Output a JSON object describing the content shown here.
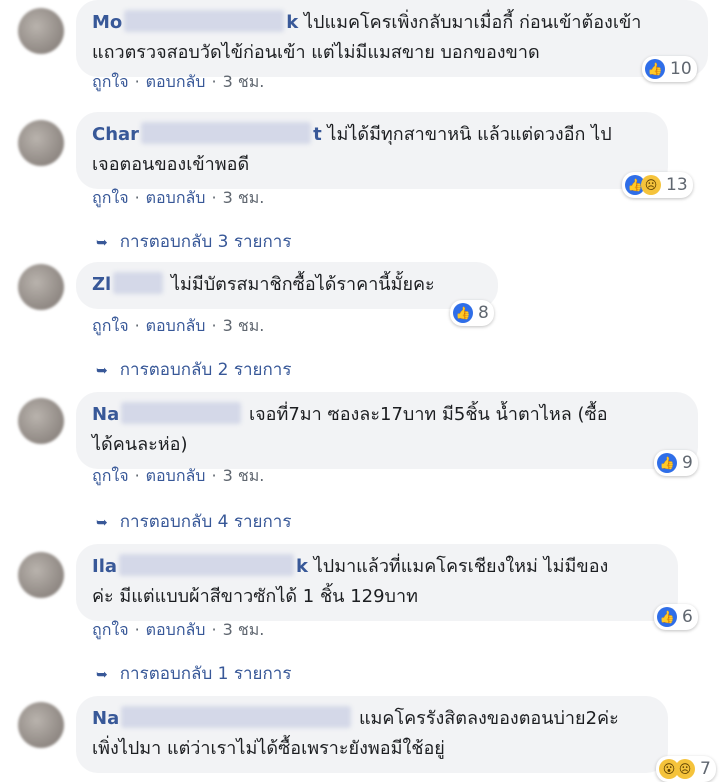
{
  "comments": [
    {
      "name": "Mo",
      "name_tail": "k",
      "text1": "ไปแมคโครเพิ่งกลับมาเมื่อกี้ ก่อนเข้าต้องเข้า",
      "text2": "แถวตรวจสอบวัดไข้ก่อนเข้า แต่ไม่มีแมสขาย บอกของขาด",
      "like": "ถูกใจ",
      "reply": "ตอบกลับ",
      "time": "3 ชม.",
      "reactions": "10",
      "replies": ""
    },
    {
      "name": "Char",
      "name_tail": "t",
      "text1": "ไม่ได้มีทุกสาขาหนิ แล้วแต่ดวงอีก ไป",
      "text2": "เจอตอนของเข้าพอดี",
      "like": "ถูกใจ",
      "reply": "ตอบกลับ",
      "time": "3 ชม.",
      "reactions": "13",
      "replies": "การตอบกลับ 3 รายการ"
    },
    {
      "name": "Zl",
      "text1": "ไม่มีบัตรสมาชิกซื้อได้ราคานี้มั้ยคะ",
      "like": "ถูกใจ",
      "reply": "ตอบกลับ",
      "time": "3 ชม.",
      "reactions": "8",
      "replies": "การตอบกลับ 2 รายการ"
    },
    {
      "name": "Na",
      "text1": "เจอที่7มา ซองละ17บาท มี5ชิ้น น้ำตาไหล (ซื้อ",
      "text2": "ได้คนละห่อ)",
      "like": "ถูกใจ",
      "reply": "ตอบกลับ",
      "time": "3 ชม.",
      "reactions": "9",
      "replies": "การตอบกลับ 4 รายการ"
    },
    {
      "name": "Ila",
      "name_tail": "k",
      "text1": "ไปมาแล้วที่แมคโครเชียงใหม่ ไม่มีของ",
      "text2": "ค่ะ มีแต่แบบผ้าสีขาวซักได้ 1 ชิ้น 129บาท",
      "like": "ถูกใจ",
      "reply": "ตอบกลับ",
      "time": "3 ชม.",
      "reactions": "6",
      "replies": "การตอบกลับ 1 รายการ"
    },
    {
      "name": "Na",
      "text1": "แมคโครรังสิตลงของตอนบ่าย2ค่ะ",
      "text2": "เพิ่งไปมา แต่ว่าเราไม่ได้ซื้อเพราะยังพอมีใช้อยู่",
      "reactions": "7"
    }
  ],
  "colors": {
    "link": "#385898",
    "bubble": "#f2f3f5",
    "like_blue": "#2f6ee8",
    "meta": "#606770"
  },
  "icons": [
    "like-icon",
    "sad-icon",
    "wow-icon",
    "reply-arrow-icon",
    "avatar"
  ]
}
